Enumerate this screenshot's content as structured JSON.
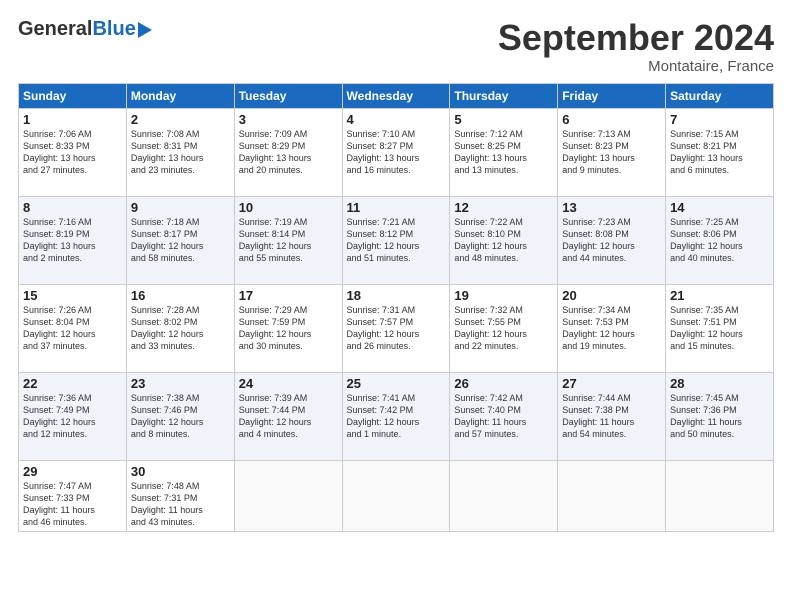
{
  "header": {
    "logo_general": "General",
    "logo_blue": "Blue",
    "month_title": "September 2024",
    "location": "Montataire, France"
  },
  "days_of_week": [
    "Sunday",
    "Monday",
    "Tuesday",
    "Wednesday",
    "Thursday",
    "Friday",
    "Saturday"
  ],
  "weeks": [
    [
      {
        "day": "1",
        "lines": [
          "Sunrise: 7:06 AM",
          "Sunset: 8:33 PM",
          "Daylight: 13 hours",
          "and 27 minutes."
        ]
      },
      {
        "day": "2",
        "lines": [
          "Sunrise: 7:08 AM",
          "Sunset: 8:31 PM",
          "Daylight: 13 hours",
          "and 23 minutes."
        ]
      },
      {
        "day": "3",
        "lines": [
          "Sunrise: 7:09 AM",
          "Sunset: 8:29 PM",
          "Daylight: 13 hours",
          "and 20 minutes."
        ]
      },
      {
        "day": "4",
        "lines": [
          "Sunrise: 7:10 AM",
          "Sunset: 8:27 PM",
          "Daylight: 13 hours",
          "and 16 minutes."
        ]
      },
      {
        "day": "5",
        "lines": [
          "Sunrise: 7:12 AM",
          "Sunset: 8:25 PM",
          "Daylight: 13 hours",
          "and 13 minutes."
        ]
      },
      {
        "day": "6",
        "lines": [
          "Sunrise: 7:13 AM",
          "Sunset: 8:23 PM",
          "Daylight: 13 hours",
          "and 9 minutes."
        ]
      },
      {
        "day": "7",
        "lines": [
          "Sunrise: 7:15 AM",
          "Sunset: 8:21 PM",
          "Daylight: 13 hours",
          "and 6 minutes."
        ]
      }
    ],
    [
      {
        "day": "8",
        "lines": [
          "Sunrise: 7:16 AM",
          "Sunset: 8:19 PM",
          "Daylight: 13 hours",
          "and 2 minutes."
        ]
      },
      {
        "day": "9",
        "lines": [
          "Sunrise: 7:18 AM",
          "Sunset: 8:17 PM",
          "Daylight: 12 hours",
          "and 58 minutes."
        ]
      },
      {
        "day": "10",
        "lines": [
          "Sunrise: 7:19 AM",
          "Sunset: 8:14 PM",
          "Daylight: 12 hours",
          "and 55 minutes."
        ]
      },
      {
        "day": "11",
        "lines": [
          "Sunrise: 7:21 AM",
          "Sunset: 8:12 PM",
          "Daylight: 12 hours",
          "and 51 minutes."
        ]
      },
      {
        "day": "12",
        "lines": [
          "Sunrise: 7:22 AM",
          "Sunset: 8:10 PM",
          "Daylight: 12 hours",
          "and 48 minutes."
        ]
      },
      {
        "day": "13",
        "lines": [
          "Sunrise: 7:23 AM",
          "Sunset: 8:08 PM",
          "Daylight: 12 hours",
          "and 44 minutes."
        ]
      },
      {
        "day": "14",
        "lines": [
          "Sunrise: 7:25 AM",
          "Sunset: 8:06 PM",
          "Daylight: 12 hours",
          "and 40 minutes."
        ]
      }
    ],
    [
      {
        "day": "15",
        "lines": [
          "Sunrise: 7:26 AM",
          "Sunset: 8:04 PM",
          "Daylight: 12 hours",
          "and 37 minutes."
        ]
      },
      {
        "day": "16",
        "lines": [
          "Sunrise: 7:28 AM",
          "Sunset: 8:02 PM",
          "Daylight: 12 hours",
          "and 33 minutes."
        ]
      },
      {
        "day": "17",
        "lines": [
          "Sunrise: 7:29 AM",
          "Sunset: 7:59 PM",
          "Daylight: 12 hours",
          "and 30 minutes."
        ]
      },
      {
        "day": "18",
        "lines": [
          "Sunrise: 7:31 AM",
          "Sunset: 7:57 PM",
          "Daylight: 12 hours",
          "and 26 minutes."
        ]
      },
      {
        "day": "19",
        "lines": [
          "Sunrise: 7:32 AM",
          "Sunset: 7:55 PM",
          "Daylight: 12 hours",
          "and 22 minutes."
        ]
      },
      {
        "day": "20",
        "lines": [
          "Sunrise: 7:34 AM",
          "Sunset: 7:53 PM",
          "Daylight: 12 hours",
          "and 19 minutes."
        ]
      },
      {
        "day": "21",
        "lines": [
          "Sunrise: 7:35 AM",
          "Sunset: 7:51 PM",
          "Daylight: 12 hours",
          "and 15 minutes."
        ]
      }
    ],
    [
      {
        "day": "22",
        "lines": [
          "Sunrise: 7:36 AM",
          "Sunset: 7:49 PM",
          "Daylight: 12 hours",
          "and 12 minutes."
        ]
      },
      {
        "day": "23",
        "lines": [
          "Sunrise: 7:38 AM",
          "Sunset: 7:46 PM",
          "Daylight: 12 hours",
          "and 8 minutes."
        ]
      },
      {
        "day": "24",
        "lines": [
          "Sunrise: 7:39 AM",
          "Sunset: 7:44 PM",
          "Daylight: 12 hours",
          "and 4 minutes."
        ]
      },
      {
        "day": "25",
        "lines": [
          "Sunrise: 7:41 AM",
          "Sunset: 7:42 PM",
          "Daylight: 12 hours",
          "and 1 minute."
        ]
      },
      {
        "day": "26",
        "lines": [
          "Sunrise: 7:42 AM",
          "Sunset: 7:40 PM",
          "Daylight: 11 hours",
          "and 57 minutes."
        ]
      },
      {
        "day": "27",
        "lines": [
          "Sunrise: 7:44 AM",
          "Sunset: 7:38 PM",
          "Daylight: 11 hours",
          "and 54 minutes."
        ]
      },
      {
        "day": "28",
        "lines": [
          "Sunrise: 7:45 AM",
          "Sunset: 7:36 PM",
          "Daylight: 11 hours",
          "and 50 minutes."
        ]
      }
    ],
    [
      {
        "day": "29",
        "lines": [
          "Sunrise: 7:47 AM",
          "Sunset: 7:33 PM",
          "Daylight: 11 hours",
          "and 46 minutes."
        ]
      },
      {
        "day": "30",
        "lines": [
          "Sunrise: 7:48 AM",
          "Sunset: 7:31 PM",
          "Daylight: 11 hours",
          "and 43 minutes."
        ]
      },
      {
        "day": "",
        "lines": []
      },
      {
        "day": "",
        "lines": []
      },
      {
        "day": "",
        "lines": []
      },
      {
        "day": "",
        "lines": []
      },
      {
        "day": "",
        "lines": []
      }
    ]
  ]
}
